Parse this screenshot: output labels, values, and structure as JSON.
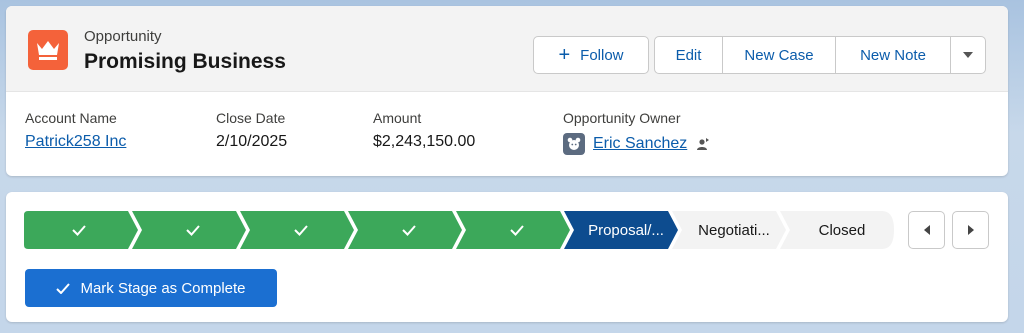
{
  "colors": {
    "complete_stage": "#3ca85a",
    "current_stage": "#0d4c8f",
    "incomplete_stage": "#f3f3f3",
    "link": "#0b5cab",
    "brand_button": "#1b6fd1",
    "object_icon": "#f4623a"
  },
  "header": {
    "object_type": "Opportunity",
    "record_name": "Promising Business",
    "object_icon": "crown-icon",
    "actions": {
      "follow_label": "Follow",
      "edit_label": "Edit",
      "new_case_label": "New Case",
      "new_note_label": "New Note",
      "more_icon": "chevron-down-icon"
    }
  },
  "fields": {
    "account_name": {
      "label": "Account Name",
      "value": "Patrick258 Inc"
    },
    "close_date": {
      "label": "Close Date",
      "value": "2/10/2025"
    },
    "amount": {
      "label": "Amount",
      "value": "$2,243,150.00"
    },
    "owner": {
      "label": "Opportunity Owner",
      "value": "Eric Sanchez"
    }
  },
  "path": {
    "stages": [
      {
        "label": "",
        "status": "complete"
      },
      {
        "label": "",
        "status": "complete"
      },
      {
        "label": "",
        "status": "complete"
      },
      {
        "label": "",
        "status": "complete"
      },
      {
        "label": "",
        "status": "complete"
      },
      {
        "label": "Proposal/...",
        "status": "current"
      },
      {
        "label": "Negotiati...",
        "status": "incomplete"
      },
      {
        "label": "Closed",
        "status": "incomplete"
      }
    ],
    "mark_complete_label": "Mark Stage as Complete"
  }
}
